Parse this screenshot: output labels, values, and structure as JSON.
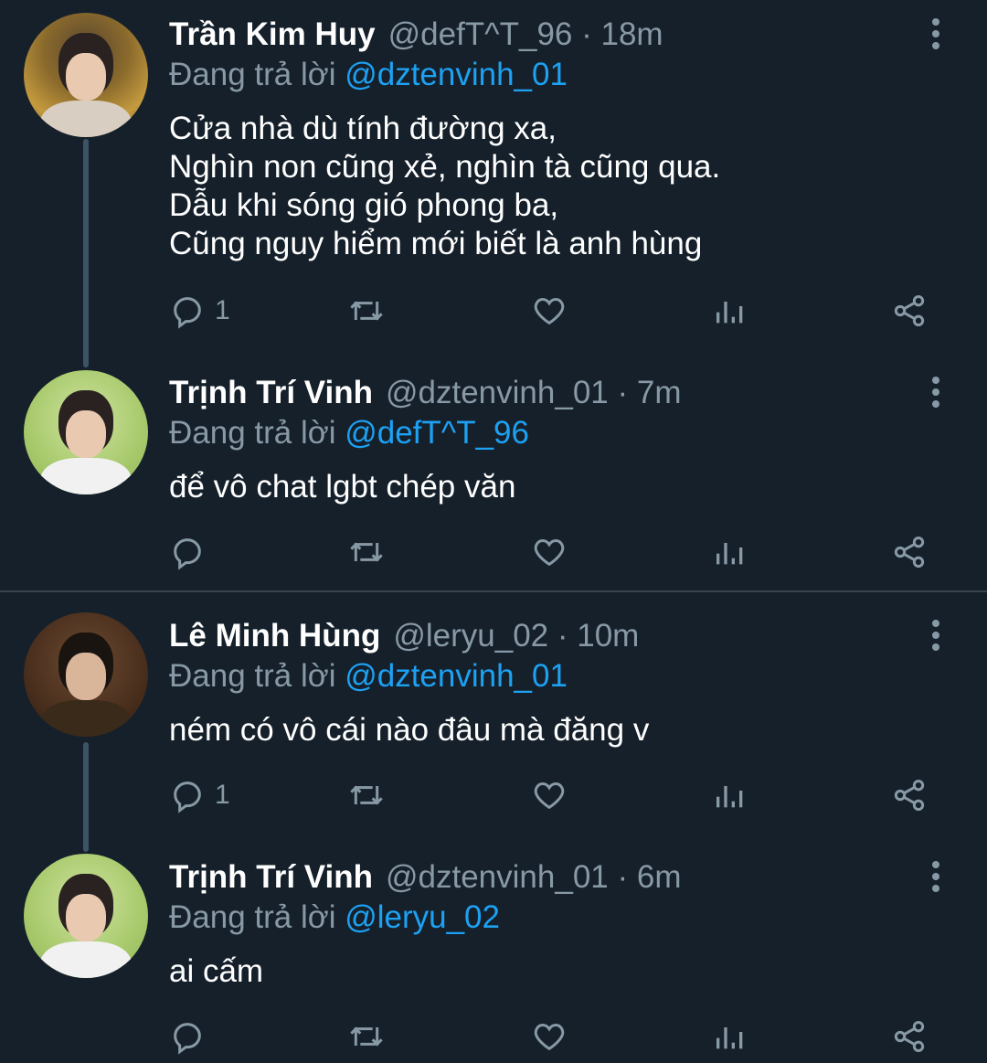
{
  "reply_prefix": "Đang trả lời",
  "tweets": [
    {
      "name": "Trần Kim Huy",
      "meta": "@defT^T_96 · 18m",
      "reply_to": "@dztenvinh_01",
      "text": "Cửa nhà dù tính đường xa,\nNghìn non cũng xẻ, nghìn tà cũng qua.\nDẫu khi sóng gió phong ba,\nCũng nguy hiểm mới biết là anh hùng",
      "reply_count": "1"
    },
    {
      "name": "Trịnh Trí Vinh",
      "meta": "@dztenvinh_01 · 7m",
      "reply_to": "@defT^T_96",
      "text": "để vô chat lgbt chép văn",
      "reply_count": ""
    },
    {
      "name": "Lê Minh Hùng",
      "meta": "@leryu_02 · 10m",
      "reply_to": "@dztenvinh_01",
      "text": "ném có vô cái nào đâu mà đăng v",
      "reply_count": "1"
    },
    {
      "name": "Trịnh Trí Vinh",
      "meta": "@dztenvinh_01 · 6m",
      "reply_to": "@leryu_02",
      "text": "ai cấm",
      "reply_count": ""
    }
  ],
  "colors": {
    "background": "#15202b",
    "secondary_text": "#8899a6",
    "mention": "#1da1f2",
    "thread_line": "#3d5466",
    "divider": "#38444d"
  },
  "icons": [
    "reply-icon",
    "retweet-icon",
    "like-icon",
    "analytics-icon",
    "share-icon",
    "more-options-icon"
  ]
}
